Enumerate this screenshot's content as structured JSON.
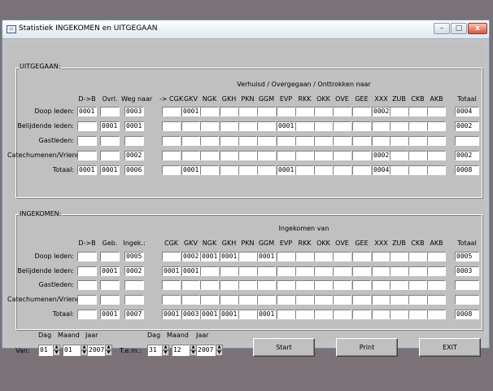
{
  "window": {
    "title": "Statistiek INGEKOMEN en UITGEGAAN",
    "minimize": "–",
    "maximize": "□",
    "close": "x"
  },
  "sections": [
    {
      "title": "UITGEGAAN:",
      "header": "Verhuisd / Overgegaan / Onttrokken naar",
      "columns": [
        "D->B",
        "Ovrl.",
        "Weg naar",
        "-> CGK",
        "GKV",
        "NGK",
        "GKH",
        "PKN",
        "GGM",
        "EVP",
        "RKK",
        "OKK",
        "OVE",
        "GEE",
        "XXX",
        "ZUB",
        "CKB",
        "AKB",
        "Totaal"
      ],
      "rows": [
        {
          "label": "Doop leden:",
          "cells": [
            "0001",
            "",
            "0003",
            "",
            "0001",
            "",
            "",
            "",
            "",
            "",
            "",
            "",
            "",
            "",
            "0002",
            "",
            "",
            "",
            "0004"
          ]
        },
        {
          "label": "Belijdende leden:",
          "cells": [
            "",
            "0001",
            "0001",
            "",
            "",
            "",
            "",
            "",
            "",
            "0001",
            "",
            "",
            "",
            "",
            "",
            "",
            "",
            "",
            "0002"
          ]
        },
        {
          "label": "Gastleden:",
          "cells": [
            "",
            "",
            "",
            "",
            "",
            "",
            "",
            "",
            "",
            "",
            "",
            "",
            "",
            "",
            "",
            "",
            "",
            "",
            ""
          ]
        },
        {
          "label": "Catechumenen/Vrienden:",
          "cells": [
            "",
            "",
            "0002",
            "",
            "",
            "",
            "",
            "",
            "",
            "",
            "",
            "",
            "",
            "",
            "0002",
            "",
            "",
            "",
            "0002"
          ]
        },
        {
          "label": "Totaal:",
          "cells": [
            "0001",
            "0001",
            "0006",
            "",
            "0001",
            "",
            "",
            "",
            "",
            "0001",
            "",
            "",
            "",
            "",
            "0004",
            "",
            "",
            "",
            "0008"
          ]
        }
      ]
    },
    {
      "title": "INGEKOMEN:",
      "header": "Ingekomen van",
      "columns": [
        "D->B",
        "Geb.",
        "Ingek.:",
        "CGK",
        "GKV",
        "NGK",
        "GKH",
        "PKN",
        "GGM",
        "EVP",
        "RKK",
        "OKK",
        "OVE",
        "GEE",
        "XXX",
        "ZUB",
        "CKB",
        "AKB",
        "Totaal"
      ],
      "rows": [
        {
          "label": "Doop leden:",
          "cells": [
            "",
            "",
            "0005",
            "",
            "0002",
            "0001",
            "0001",
            "",
            "0001",
            "",
            "",
            "",
            "",
            "",
            "",
            "",
            "",
            "",
            "0005"
          ]
        },
        {
          "label": "Belijdende leden:",
          "cells": [
            "",
            "0001",
            "0002",
            "0001",
            "0001",
            "",
            "",
            "",
            "",
            "",
            "",
            "",
            "",
            "",
            "",
            "",
            "",
            "",
            "0003"
          ]
        },
        {
          "label": "Gastleden:",
          "cells": [
            "",
            "",
            "",
            "",
            "",
            "",
            "",
            "",
            "",
            "",
            "",
            "",
            "",
            "",
            "",
            "",
            "",
            "",
            ""
          ]
        },
        {
          "label": "Catechumenen/Vrienden:",
          "cells": [
            "",
            "",
            "",
            "",
            "",
            "",
            "",
            "",
            "",
            "",
            "",
            "",
            "",
            "",
            "",
            "",
            "",
            "",
            ""
          ]
        },
        {
          "label": "Totaal:",
          "cells": [
            "",
            "0001",
            "0007",
            "0001",
            "0003",
            "0001",
            "0001",
            "",
            "0001",
            "",
            "",
            "",
            "",
            "",
            "",
            "",
            "",
            "",
            "0008"
          ]
        }
      ]
    }
  ],
  "dates": {
    "labels": {
      "dag": "Dag",
      "maand": "Maand",
      "jaar": "Jaar"
    },
    "van": {
      "label": "Van:",
      "dag": "01",
      "maand": "01",
      "jaar": "2007"
    },
    "tem": {
      "label": "T.e.m.:",
      "dag": "31",
      "maand": "12",
      "jaar": "2007"
    }
  },
  "buttons": {
    "start": "Start",
    "print": "Print",
    "exit": "EXIT"
  }
}
